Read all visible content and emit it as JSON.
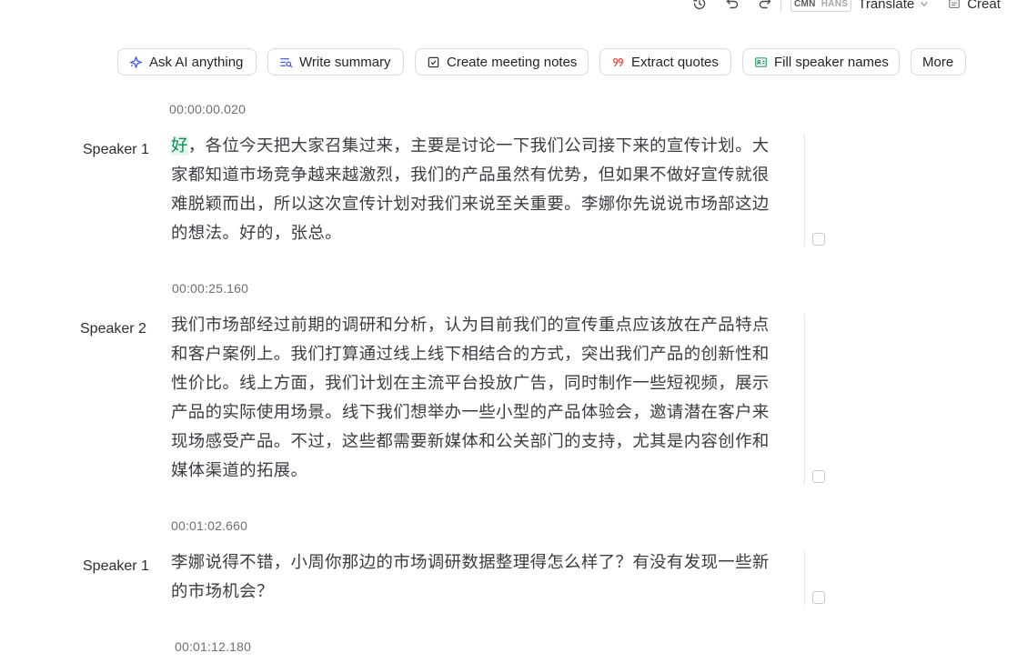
{
  "toolbar": {
    "history_icon": "history-icon",
    "undo_icon": "undo-icon",
    "redo_icon": "redo-icon",
    "lang_code_primary": "CMN",
    "lang_code_secondary": "HANS",
    "translate_label": "Translate",
    "create_label": "Creat"
  },
  "actions": [
    {
      "label": "Ask AI anything",
      "icon": "sparkle-icon",
      "color": "#3b5bdb"
    },
    {
      "label": "Write summary",
      "icon": "summary-icon",
      "color": "#3b5bdb"
    },
    {
      "label": "Create meeting notes",
      "icon": "checkbox-icon",
      "color": "#333333"
    },
    {
      "label": "Extract quotes",
      "icon": "quote-icon",
      "color": "#e0564a"
    },
    {
      "label": "Fill speaker names",
      "icon": "id-card-icon",
      "color": "#2f9e6b"
    },
    {
      "label": "More",
      "icon": "",
      "color": ""
    }
  ],
  "transcript": [
    {
      "timestamp": "00:00:00.020",
      "speaker": "Speaker 1",
      "highlight": "好",
      "text": "，各位今天把大家召集过来，主要是讨论一下我们公司接下来的宣传计划。大家都知道市场竞争越来越激烈，我们的产品虽然有优势，但如果不做好宣传就很难脱颖而出，所以这次宣传计划对我们来说至关重要。李娜你先说说市场部这边的想法。好的，张总。"
    },
    {
      "timestamp": "00:00:25.160",
      "speaker": "Speaker 2",
      "highlight": "",
      "text": "我们市场部经过前期的调研和分析，认为目前我们的宣传重点应该放在产品特点和客户案例上。我们打算通过线上线下相结合的方式，突出我们产品的创新性和性价比。线上方面，我们计划在主流平台投放广告，同时制作一些短视频，展示产品的实际使用场景。线下我们想举办一些小型的产品体验会，邀请潜在客户来现场感受产品。不过，这些都需要新媒体和公关部门的支持，尤其是内容创作和媒体渠道的拓展。"
    },
    {
      "timestamp": "00:01:02.660",
      "speaker": "Speaker 1",
      "highlight": "",
      "text": "李娜说得不错，小周你那边的市场调研数据整理得怎么样了？有没有发现一些新的市场机会？"
    },
    {
      "timestamp": "00:01:12.180",
      "speaker": "",
      "highlight": "",
      "text": ""
    }
  ]
}
